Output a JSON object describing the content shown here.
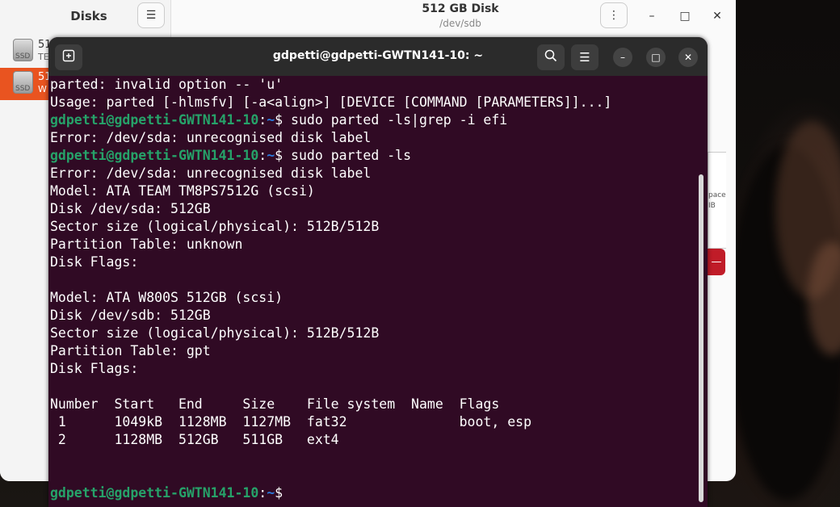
{
  "disks_window": {
    "title": "Disks",
    "menu_icon": "hamburger-icon",
    "items": [
      {
        "name": "51",
        "sub": "TE",
        "icon_label": "SSD"
      },
      {
        "name": "51",
        "sub": "W",
        "icon_label": "SSD"
      }
    ],
    "main_title": "512 GB Disk",
    "main_subtitle": "/dev/sdb",
    "partial_text_1": "pace",
    "partial_text_2": "IB",
    "delete_symbol": "—"
  },
  "terminal": {
    "title": "gdpetti@gdpetti-GWTN141-10: ~",
    "new_tab_icon": "new-tab-icon",
    "lines": [
      {
        "text": "parted: invalid option -- 'u'"
      },
      {
        "text": "Usage: parted [-hlmsfv] [-a<align>] [DEVICE [COMMAND [PARAMETERS]]...]"
      },
      {
        "user": "gdpetti@gdpetti-GWTN141-10",
        "sep": ":",
        "path": "~",
        "cmd": "$ sudo parted -ls|grep -i efi"
      },
      {
        "text": "Error: /dev/sda: unrecognised disk label"
      },
      {
        "user": "gdpetti@gdpetti-GWTN141-10",
        "sep": ":",
        "path": "~",
        "cmd": "$ sudo parted -ls"
      },
      {
        "text": "Error: /dev/sda: unrecognised disk label"
      },
      {
        "text": "Model: ATA TEAM TM8PS7512G (scsi)"
      },
      {
        "text": "Disk /dev/sda: 512GB"
      },
      {
        "text": "Sector size (logical/physical): 512B/512B"
      },
      {
        "text": "Partition Table: unknown"
      },
      {
        "text": "Disk Flags:"
      },
      {
        "text": ""
      },
      {
        "text": "Model: ATA W800S 512GB (scsi)"
      },
      {
        "text": "Disk /dev/sdb: 512GB"
      },
      {
        "text": "Sector size (logical/physical): 512B/512B"
      },
      {
        "text": "Partition Table: gpt"
      },
      {
        "text": "Disk Flags:"
      },
      {
        "text": ""
      },
      {
        "text": "Number  Start   End     Size    File system  Name  Flags"
      },
      {
        "text": " 1      1049kB  1128MB  1127MB  fat32              boot, esp"
      },
      {
        "text": " 2      1128MB  512GB   511GB   ext4"
      },
      {
        "text": ""
      },
      {
        "text": ""
      },
      {
        "user": "gdpetti@gdpetti-GWTN141-10",
        "sep": ":",
        "path": "~",
        "cmd": "$ "
      }
    ]
  }
}
